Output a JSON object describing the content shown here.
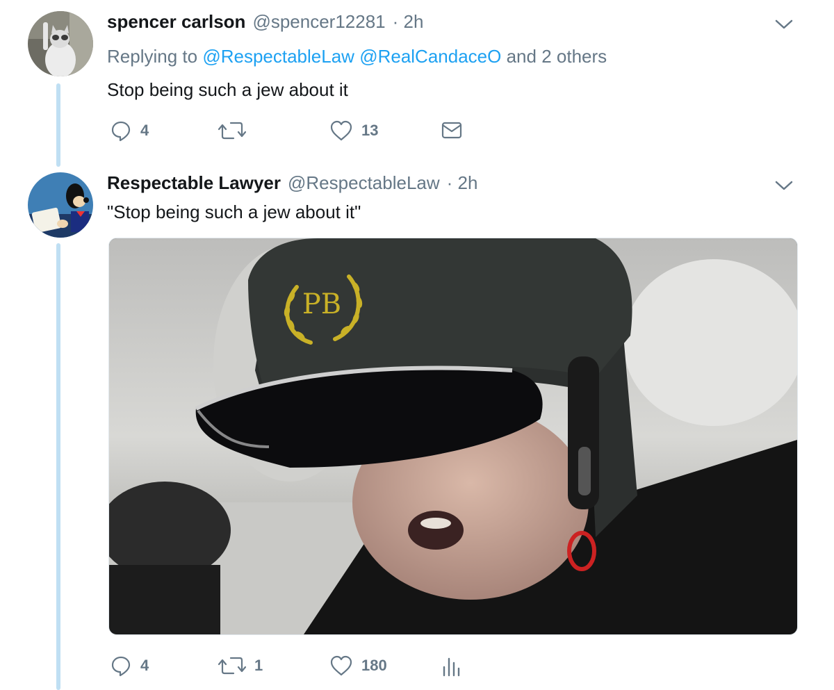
{
  "tweets": [
    {
      "name": "spencer carlson",
      "handle": "@spencer12281",
      "time": "· 2h",
      "replying": {
        "prefix": "Replying to",
        "mention1": "@RespectableLaw",
        "mention2": "@RealCandaceO",
        "suffix": "and 2 others"
      },
      "text": "Stop being such a jew about it",
      "actions": {
        "replies": "4",
        "retweets": "",
        "likes": "13"
      },
      "avatar_icon": "cat-avatar-icon"
    },
    {
      "name": "Respectable Lawyer",
      "handle": "@RespectableLaw",
      "time": "· 2h",
      "text": "\"Stop being such a jew about it\"",
      "actions": {
        "replies": "4",
        "retweets": "1",
        "likes": "180"
      },
      "media": {
        "helmet_text": "PB"
      },
      "avatar_icon": "cartoon-dog-avatar-icon"
    }
  ],
  "colors": {
    "link": "#1da1f2",
    "muted": "#657786",
    "thread": "#bfdff3"
  }
}
